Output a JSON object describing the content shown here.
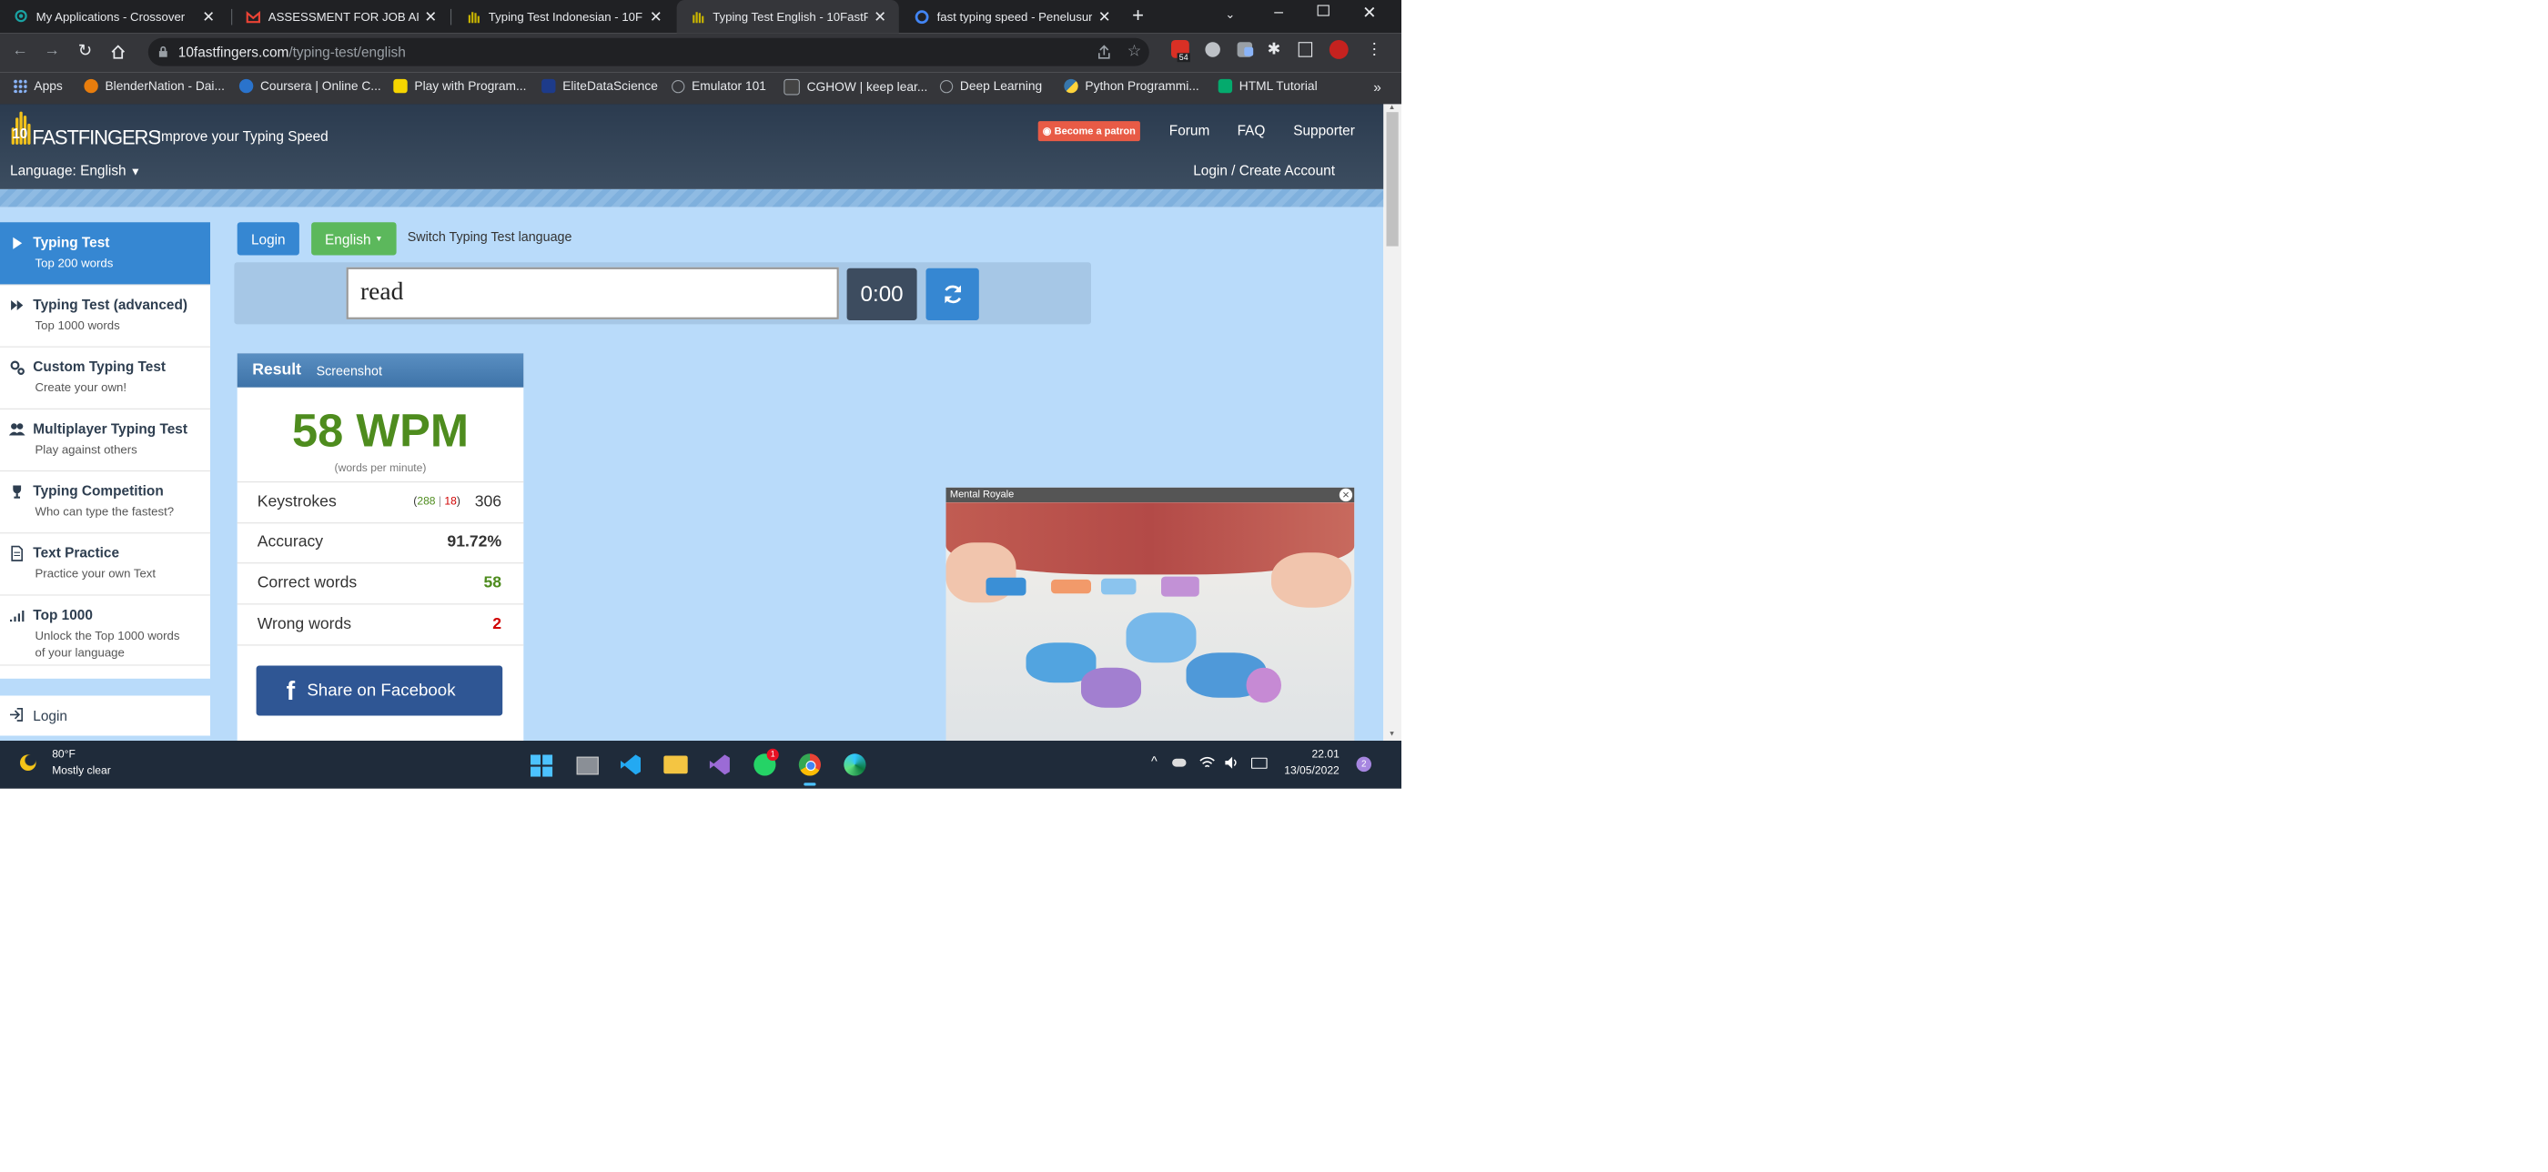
{
  "browser": {
    "tabs": [
      {
        "title": "My Applications - Crossover",
        "color": "#1aa3a3"
      },
      {
        "title": "ASSESSMENT FOR JOB APPLI",
        "color": "#ea4335"
      },
      {
        "title": "Typing Test Indonesian - 10F",
        "color": "#c8b400"
      },
      {
        "title": "Typing Test English - 10FastF",
        "color": "#c8b400"
      },
      {
        "title": "fast typing speed - Penelusur",
        "color": "#4285f4"
      }
    ],
    "active_tab": 3,
    "new_tab": "+",
    "url_host": "10fastfingers.com",
    "url_path": "/typing-test/english",
    "extension_badge": "54",
    "bookmarks": [
      {
        "label": "Apps",
        "color": "#8ab4f8"
      },
      {
        "label": "BlenderNation - Dai...",
        "color": "#e87d0d"
      },
      {
        "label": "Coursera | Online C...",
        "color": "#2a73cc"
      },
      {
        "label": "Play with Program...",
        "color": "#f6d500"
      },
      {
        "label": "EliteDataScience",
        "color": "#1d3b8a"
      },
      {
        "label": "Emulator 101",
        "color": "#9aa0a6"
      },
      {
        "label": "CGHOW | keep lear...",
        "color": "#444"
      },
      {
        "label": "Deep Learning",
        "color": "#9aa0a6"
      },
      {
        "label": "Python Programmi...",
        "color": "#3776ab"
      },
      {
        "label": "HTML Tutorial",
        "color": "#04aa6d"
      }
    ],
    "bookmarks_more": "»"
  },
  "site": {
    "logo": "FASTFINGERS",
    "logo_prefix": "10",
    "tagline": "Improve your Typing Speed",
    "patron_label": "Become a patron",
    "nav": [
      "Forum",
      "FAQ",
      "Supporter"
    ],
    "language_label": "Language: English",
    "login_create": "Login / Create Account"
  },
  "sidebar": {
    "items": [
      {
        "title": "Typing Test",
        "sub": "Top 200 words",
        "icon": "play-icon",
        "active": true
      },
      {
        "title": "Typing Test (advanced)",
        "sub": "Top 1000 words",
        "icon": "fast-forward-icon"
      },
      {
        "title": "Custom Typing Test",
        "sub": "Create your own!",
        "icon": "gears-icon"
      },
      {
        "title": "Multiplayer Typing Test",
        "sub": "Play against others",
        "icon": "users-icon"
      },
      {
        "title": "Typing Competition",
        "sub": "Who can type the fastest?",
        "icon": "trophy-icon"
      },
      {
        "title": "Text Practice",
        "sub": "Practice your own Text",
        "icon": "document-icon"
      },
      {
        "title": "Top 1000",
        "sub": "Unlock the Top 1000 words",
        "sub2": "of your language",
        "icon": "signal-icon"
      }
    ],
    "login": "Login"
  },
  "controls": {
    "login_button": "Login",
    "language_button": "English",
    "switch_label": "Switch Typing Test language",
    "input_value": "read",
    "timer": "0:00"
  },
  "result": {
    "title": "Result",
    "screenshot": "Screenshot",
    "wpm": "58 WPM",
    "wpm_caption": "(words per minute)",
    "rows": [
      {
        "label": "Keystrokes",
        "correct": "288",
        "sep": "|",
        "wrong": "18",
        "value": "306"
      },
      {
        "label": "Accuracy",
        "value": "91.72%"
      },
      {
        "label": "Correct words",
        "value": "58"
      },
      {
        "label": "Wrong words",
        "value": "2"
      }
    ],
    "share": "Share on Facebook"
  },
  "ad": {
    "label": "Mental Royale",
    "close": "×"
  },
  "taskbar": {
    "weather_temp": "80°F",
    "weather_desc": "Mostly clear",
    "time": "22.01",
    "date": "13/05/2022",
    "notif_count": "2",
    "whatsapp_badge": "1"
  },
  "colors": {
    "accent": "#3687d2",
    "green": "#5cb85c",
    "wpm_green": "#4e8c1e",
    "wrong_red": "#d00000"
  }
}
